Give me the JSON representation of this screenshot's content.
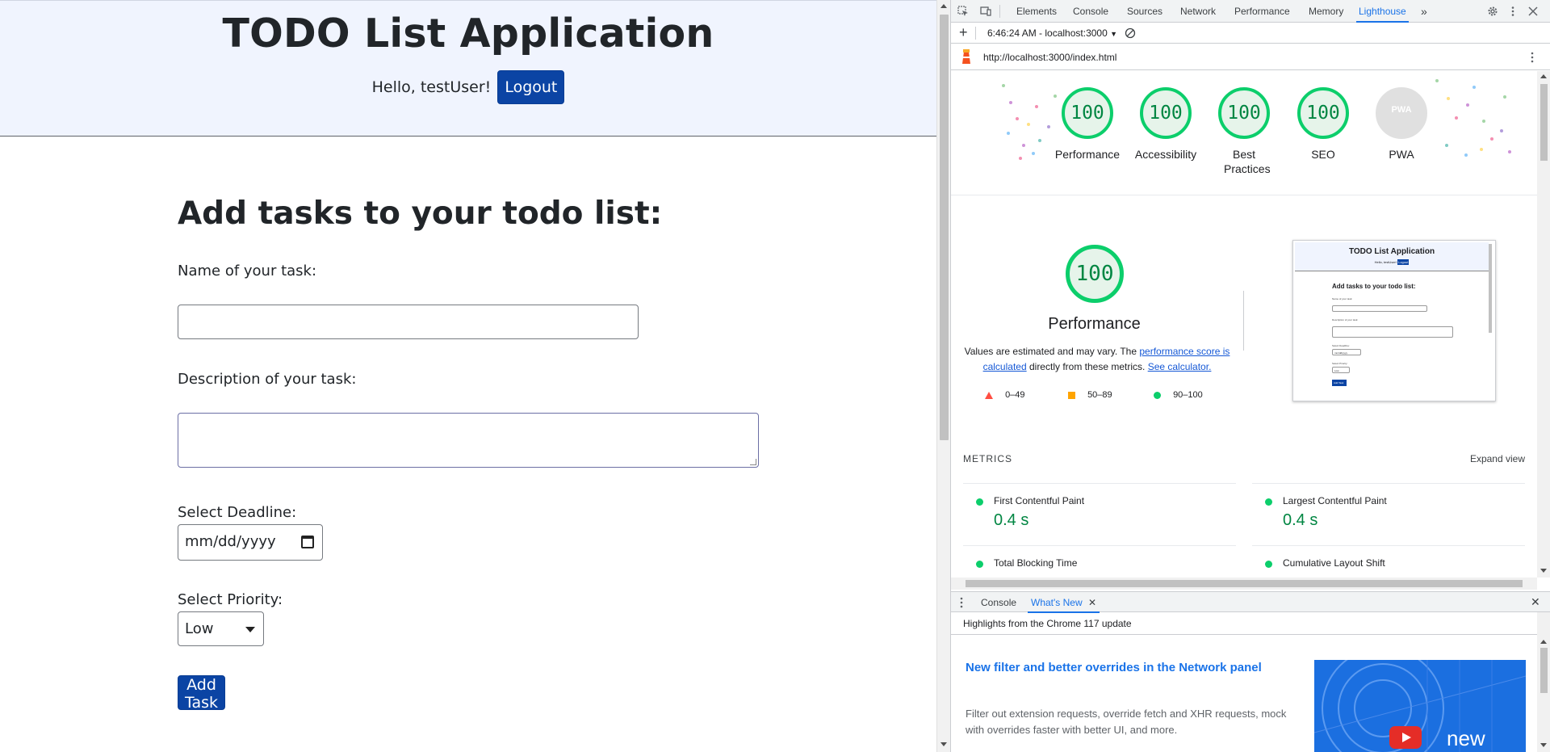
{
  "page": {
    "title": "TODO List Application",
    "greeting": "Hello, testUser!",
    "logout_label": "Logout",
    "form_title": "Add tasks to your todo list:",
    "task_name_label": "Name of your task:",
    "task_desc_label": "Description of your task:",
    "deadline_label": "Select Deadline:",
    "deadline_placeholder": "mm/dd/yyyy",
    "priority_label": "Select Priority:",
    "priority_value": "Low",
    "add_task_label": "Add Task"
  },
  "devtools": {
    "tabs": [
      "Elements",
      "Console",
      "Sources",
      "Network",
      "Performance",
      "Memory",
      "Lighthouse"
    ],
    "active_tab": "Lighthouse",
    "report_selector": "6:46:24 AM - localhost:3000",
    "url": "http://localhost:3000/index.html",
    "scores": [
      {
        "label": "Performance",
        "value": "100"
      },
      {
        "label": "Accessibility",
        "value": "100"
      },
      {
        "label": "Best Practices",
        "value": "100"
      },
      {
        "label": "SEO",
        "value": "100"
      },
      {
        "label": "PWA",
        "value": "PWA"
      }
    ],
    "perf_score": "100",
    "perf_title": "Performance",
    "note_prefix": "Values are estimated and may vary. The ",
    "note_link1": "performance score is calculated",
    "note_mid": " directly from these metrics. ",
    "note_link2": "See calculator.",
    "legend": [
      "0–49",
      "50–89",
      "90–100"
    ],
    "thumb": {
      "title": "TODO List Application",
      "greeting": "Hello, testUser!",
      "logout": "Logout",
      "form_title": "Add tasks to your todo list:",
      "name_label": "Name of your task:",
      "desc_label": "Description of your task:",
      "deadline_label": "Select Deadline:",
      "date": "mm/dd/yyyy",
      "priority_label": "Select Priority:",
      "priority": "Low",
      "add": "Add Task"
    },
    "metrics_header": "METRICS",
    "expand_view": "Expand view",
    "metrics": [
      {
        "name": "First Contentful Paint",
        "value": "0.4 s"
      },
      {
        "name": "Largest Contentful Paint",
        "value": "0.4 s"
      },
      {
        "name": "Total Blocking Time",
        "value": ""
      },
      {
        "name": "Cumulative Layout Shift",
        "value": ""
      }
    ],
    "drawer_tabs": [
      "Console",
      "What's New"
    ],
    "drawer_active": "What's New",
    "drawer_subtitle": "Highlights from the Chrome 117 update",
    "whats_new_headline": "New filter and better overrides in the Network panel",
    "whats_new_body": "Filter out extension requests, override fetch and XHR requests, mock with overrides faster with better UI, and more.",
    "whats_new_image_text": "new",
    "colors": {
      "pass": "#0cce6b",
      "pass_text": "#018642",
      "average": "#ffa400",
      "fail": "#ff4e42",
      "link": "#1558d6",
      "brand": "#0b44a4"
    }
  }
}
